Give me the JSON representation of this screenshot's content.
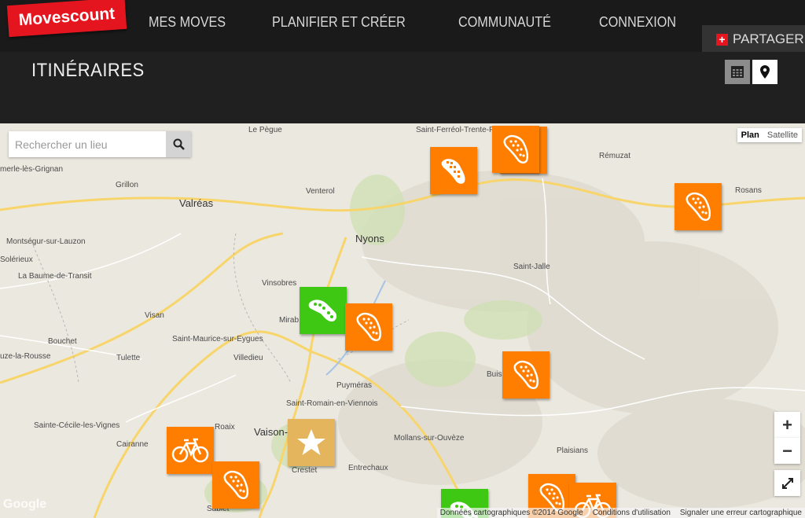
{
  "brand": {
    "logo_text": "Movescount",
    "color": "#e4151e"
  },
  "nav": [
    {
      "label": "MES MOVES"
    },
    {
      "label": "PLANIFIER ET CRÉER"
    },
    {
      "label": "COMMUNAUTÉ"
    },
    {
      "label": "CONNEXION"
    }
  ],
  "share": {
    "label": "PARTAGER"
  },
  "page": {
    "title": "ITINÉRAIRES"
  },
  "view_toggle": {
    "list_icon": "calendar-grid-icon",
    "map_icon": "map-pin-icon",
    "active": "map"
  },
  "search": {
    "placeholder": "Rechercher un lieu",
    "value": ""
  },
  "map_type": {
    "plan": "Plan",
    "satellite": "Satellite",
    "selected": "Plan"
  },
  "places": [
    {
      "name": "Le Pègue"
    },
    {
      "name": "Saint-Ferréol-Trente-Pas"
    },
    {
      "name": "Rémuzat"
    },
    {
      "name": "Rosans"
    },
    {
      "name": "merle-lès-Grignan"
    },
    {
      "name": "Grillon"
    },
    {
      "name": "Venterol"
    },
    {
      "name": "Valréas"
    },
    {
      "name": "Nyons"
    },
    {
      "name": "Montségur-sur-Lauzon"
    },
    {
      "name": "Solérieux"
    },
    {
      "name": "Saint-Jalle"
    },
    {
      "name": "La Baume-de-Transit"
    },
    {
      "name": "Vinsobres"
    },
    {
      "name": "Visan"
    },
    {
      "name": "Mirab"
    },
    {
      "name": "Saint-Maurice-sur-Eygues"
    },
    {
      "name": "Bouchet"
    },
    {
      "name": "Villedieu"
    },
    {
      "name": "uze-la-Rousse"
    },
    {
      "name": "Tulette"
    },
    {
      "name": "Puyméras"
    },
    {
      "name": "Buis"
    },
    {
      "name": "Saint-Romain-en-Viennois"
    },
    {
      "name": "Sainte-Cécile-les-Vignes"
    },
    {
      "name": "Roaix"
    },
    {
      "name": "Vaison-"
    },
    {
      "name": "Mollans-sur-Ouvèze"
    },
    {
      "name": "Cairanne"
    },
    {
      "name": "Plaisians"
    },
    {
      "name": "Crestet"
    },
    {
      "name": "Entrechaux"
    },
    {
      "name": "Sablet"
    }
  ],
  "markers": [
    {
      "kind": "hiking",
      "color": "orange"
    },
    {
      "kind": "hiking",
      "color": "orange"
    },
    {
      "kind": "hiking",
      "color": "orange"
    },
    {
      "kind": "trail",
      "color": "orange"
    },
    {
      "kind": "running",
      "color": "green"
    },
    {
      "kind": "hiking",
      "color": "orange"
    },
    {
      "kind": "hiking",
      "color": "orange"
    },
    {
      "kind": "favorite",
      "color": "gold"
    },
    {
      "kind": "cycling",
      "color": "orange"
    },
    {
      "kind": "hiking",
      "color": "orange"
    },
    {
      "kind": "hiking",
      "color": "orange"
    },
    {
      "kind": "cycling",
      "color": "orange"
    },
    {
      "kind": "running",
      "color": "green"
    }
  ],
  "zoom": {
    "in": "+",
    "out": "−"
  },
  "footer": {
    "google": "Google",
    "data": "Données cartographiques ©2014 Google",
    "terms": "Conditions d'utilisation",
    "report": "Signaler une erreur cartographique"
  },
  "colors": {
    "marker_orange": "#ff7e00",
    "marker_green": "#3ec813",
    "marker_gold": "#e5b55d"
  }
}
